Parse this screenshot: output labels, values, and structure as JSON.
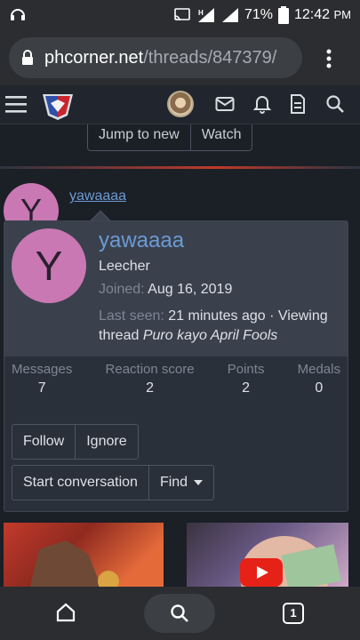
{
  "status_bar": {
    "battery": "71%",
    "time": "12:42",
    "ampm": "PM"
  },
  "browser": {
    "url_host": "phcorner.net",
    "url_path": "/threads/847379/"
  },
  "thread_buttons": {
    "jump": "Jump to new",
    "watch": "Watch"
  },
  "post": {
    "avatar_letter": "Y",
    "username": "yawaaaa"
  },
  "member_card": {
    "avatar_letter": "Y",
    "name": "yawaaaa",
    "role": "Leecher",
    "joined_label": "Joined:",
    "joined_value": "Aug 16, 2019",
    "last_seen_label": "Last seen:",
    "last_seen_value": "21 minutes ago",
    "activity_prefix": "· Viewing",
    "activity_line2": "thread",
    "activity_thread": "Puro kayo April Fools",
    "stats": [
      {
        "label": "Messages",
        "value": "7"
      },
      {
        "label": "Reaction score",
        "value": "2"
      },
      {
        "label": "Points",
        "value": "2"
      },
      {
        "label": "Medals",
        "value": "0"
      }
    ],
    "follow": "Follow",
    "ignore": "Ignore",
    "start_conversation": "Start conversation",
    "find": "Find"
  },
  "bottom_nav": {
    "tab_count": "1"
  },
  "colors": {
    "accent_link": "#6c9bd4",
    "avatar_bg": "#c978b3",
    "card_bg": "#3a414d"
  }
}
